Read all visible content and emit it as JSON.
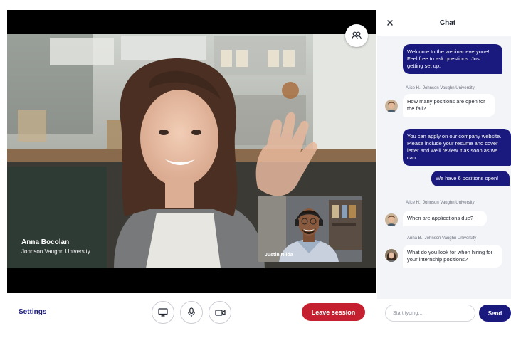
{
  "main_speaker": {
    "name": "Anna Bocolan",
    "org": "Johnson Vaughn University"
  },
  "pip_speaker": {
    "name": "Justin Niida"
  },
  "toolbar": {
    "settings_label": "Settings",
    "leave_label": "Leave session",
    "share_icon": "monitor-icon",
    "mic_icon": "microphone-icon",
    "camera_icon": "video-camera-icon"
  },
  "chat": {
    "title": "Chat",
    "input_placeholder": "Start typing...",
    "send_label": "Send",
    "messages": [
      {
        "direction": "out",
        "text": "Welcome to the webinar everyone! Feel free to ask questions. Just getting set up."
      },
      {
        "direction": "in",
        "meta": "Alice H., Johnson Vaughn University",
        "text": "How many positions are open for the fall?"
      },
      {
        "direction": "out",
        "text": "You can apply on our company website. Please include your resume and cover letter and we'll review it as soon as we can."
      },
      {
        "direction": "out",
        "text": "We have 6 positions open!"
      },
      {
        "direction": "in",
        "meta": "Alice H., Johnson Vaughn University",
        "text": "When are applications due?"
      },
      {
        "direction": "in",
        "meta": "Anna B., Johnson Vaughn University",
        "text": "What do you look for when hiring for your internship positions?"
      }
    ]
  },
  "colors": {
    "brand": "#1a1a7e",
    "leave": "#c4202f",
    "chat_bg": "#f3f4f7"
  }
}
